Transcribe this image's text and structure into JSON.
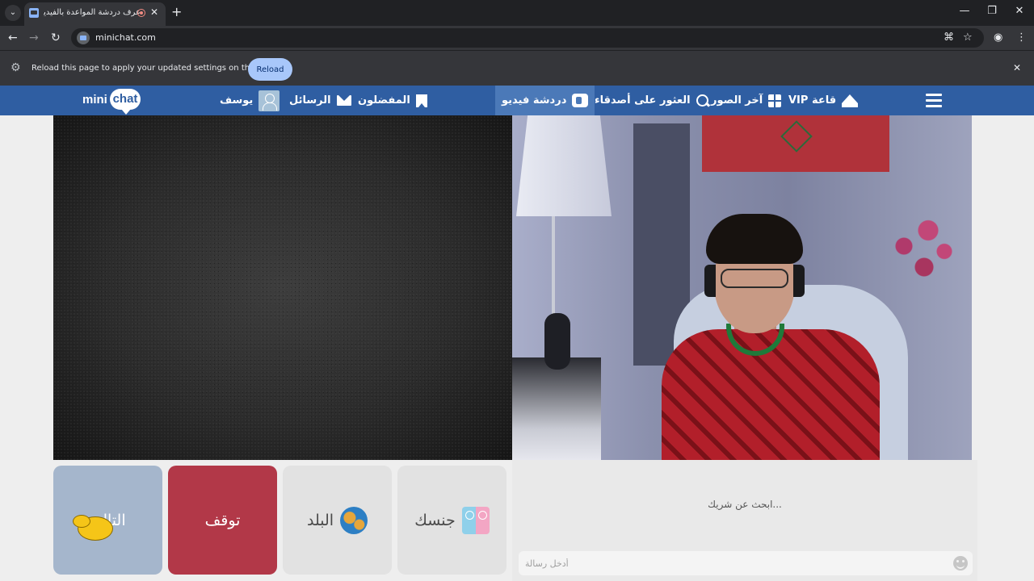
{
  "browser": {
    "tab_title": "عرف دردشة المواعدة بالفيديو",
    "tab_close": "✕",
    "new_tab": "+",
    "tab_search": "⌄",
    "url": "minichat.com",
    "window_controls": {
      "minimize": "—",
      "maximize": "❐",
      "close": "✕"
    },
    "nav_glyphs": {
      "back": "←",
      "forward": "→",
      "reload": "↻",
      "star": "☆",
      "profile": "◉",
      "menu": "⋮",
      "translate": "⌘"
    }
  },
  "infobar": {
    "message": "Reload this page to apply your updated settings on this site",
    "reload_label": "Reload",
    "close": "✕",
    "gear": "⚙"
  },
  "site": {
    "logo_mini": "mini",
    "logo_chat": "chat",
    "nav": {
      "profile_name": "يوسف",
      "messages": "الرسائل",
      "favorites": "المفضلون",
      "video_chat": "دردشة فيديو",
      "find_friends": "العثور على أصدقاء",
      "latest_photos": "آخر الصور",
      "vip_hall": "قاعة VIP"
    },
    "colors": {
      "nav_bg": "#2f5ea2",
      "nav_active": "#4b79b8",
      "stop_button": "#b23848",
      "next_button": "#a5b6cc"
    }
  },
  "controls": {
    "next_label": "التالي",
    "stop_label": "توقف",
    "country_label": "البلد",
    "gender_label": "جنسك"
  },
  "chat": {
    "status": "...ابحث عن شريك",
    "input_placeholder": "أدخل رسالة"
  }
}
